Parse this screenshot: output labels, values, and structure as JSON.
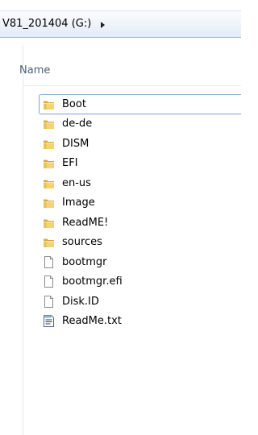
{
  "address": {
    "path": "V81_201404 (G:)"
  },
  "columns": {
    "name": "Name"
  },
  "files": [
    {
      "name": "Boot",
      "icon": "folder-icon",
      "focused": true
    },
    {
      "name": "de-de",
      "icon": "folder-icon"
    },
    {
      "name": "DISM",
      "icon": "folder-icon"
    },
    {
      "name": "EFI",
      "icon": "folder-icon"
    },
    {
      "name": "en-us",
      "icon": "folder-icon"
    },
    {
      "name": "Image",
      "icon": "folder-icon"
    },
    {
      "name": "ReadME!",
      "icon": "folder-icon"
    },
    {
      "name": "sources",
      "icon": "folder-icon"
    },
    {
      "name": "bootmgr",
      "icon": "file-icon"
    },
    {
      "name": "bootmgr.efi",
      "icon": "file-icon"
    },
    {
      "name": "Disk.ID",
      "icon": "file-icon"
    },
    {
      "name": "ReadMe.txt",
      "icon": "text-file-icon"
    }
  ],
  "colors": {
    "folder": "#e8c45a",
    "selection_border": "#7da2ce",
    "header_text": "#4c607a"
  }
}
